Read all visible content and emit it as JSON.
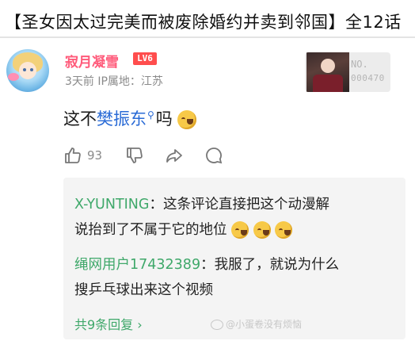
{
  "post_title": "【圣女因太过完美而被废除婚约并卖到邻国】全12话",
  "comment": {
    "username": "寂月凝雪",
    "level_badge": "LV6",
    "meta": "3天前 IP属地：江苏",
    "fan_badge": {
      "line1": "NO.",
      "line2": "000470"
    },
    "body_prefix": "这不",
    "body_keyword": "樊振东",
    "body_suffix": "吗",
    "like_count": "93",
    "icons": [
      "thumb-up-icon",
      "thumb-down-icon",
      "share-icon",
      "comment-icon"
    ]
  },
  "replies": [
    {
      "name": "X-YUNTING",
      "line1": "：这条评论直接把这个动漫解",
      "line2": "说抬到了不属于它的地位"
    },
    {
      "name": "绳网用户17432389",
      "line1": "：我服了，就说为什么",
      "line2": "搜乒乓球出来这个视频"
    }
  ],
  "reply_more": "共9条回复 ›",
  "watermark": "@小蛋卷没有烦恼",
  "colors": {
    "username": "#ff5a7a",
    "level_badge": "#ff4d4d",
    "keyword": "#2a6bd6",
    "reply_name": "#3fa86a"
  }
}
